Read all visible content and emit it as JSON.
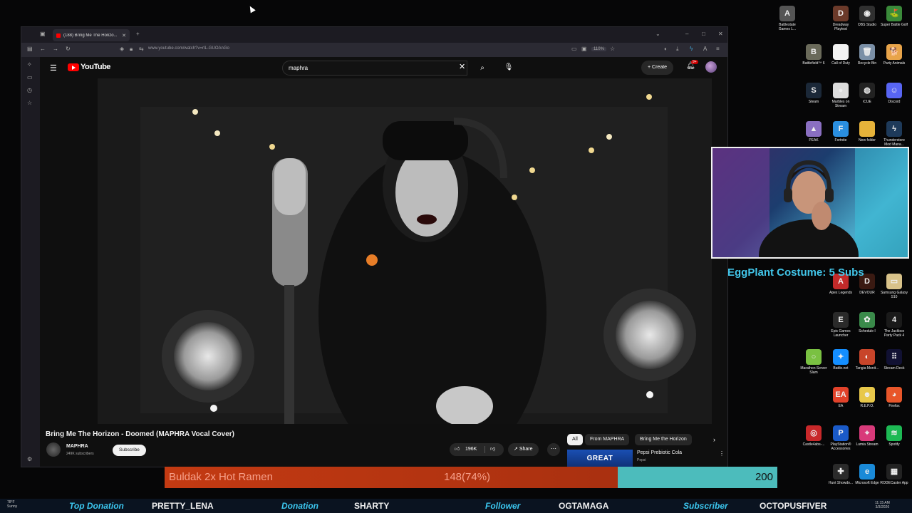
{
  "browser": {
    "tab_title": "(188) Bring Me The Horizo...",
    "url": "www.youtube.com/watch?v=rIL-GUOAnGo",
    "zoom": "110%"
  },
  "youtube": {
    "logo_text": "YouTube",
    "search_query": "maphra",
    "create_label": "Create",
    "notification_count": "9+",
    "video_title": "Bring Me The Horizon - Doomed (MAPHRA Vocal Cover)",
    "channel_name": "MAPHRA",
    "channel_subs": "249K subscribers",
    "subscribe_label": "Subscribe",
    "likes": "196K",
    "share_label": "Share",
    "chips": [
      "All",
      "From MAPHRA",
      "Bring Me the Horizon"
    ],
    "ad": {
      "thumb_text": "GREAT",
      "title": "Pepsi Prebiotic Cola",
      "brand": "Pepsi"
    }
  },
  "desktop_icons": [
    {
      "label": "Battlestate Games L...",
      "icon": "battlestate-icon",
      "color": "#555555",
      "glyph": "A"
    },
    {
      "label": "Dreadway Playtest",
      "icon": "dreadway-icon",
      "color": "#6b3a2a",
      "glyph": "D"
    },
    {
      "label": "OBS Studio",
      "icon": "obs-icon",
      "color": "#303030",
      "glyph": "◉"
    },
    {
      "label": "Super Battle Golf",
      "icon": "golf-icon",
      "color": "#3a8a3a",
      "glyph": "⛳"
    },
    {
      "label": "Battlefield™ 6",
      "icon": "battlefield-icon",
      "color": "#6a6a5a",
      "glyph": "B"
    },
    {
      "label": "Call of Duty",
      "icon": "cod-icon",
      "color": "#f2f2f2",
      "glyph": ""
    },
    {
      "label": "Recycle Bin",
      "icon": "recycle-bin-icon",
      "color": "#7a8fa6",
      "glyph": "🗑"
    },
    {
      "label": "Party Animals",
      "icon": "party-animals-icon",
      "color": "#e8a44a",
      "glyph": "🐕"
    },
    {
      "label": "Steam",
      "icon": "steam-icon",
      "color": "#1b2838",
      "glyph": "S"
    },
    {
      "label": "Marbles on Stream",
      "icon": "marbles-icon",
      "color": "#dddddd",
      "glyph": "●"
    },
    {
      "label": "iCUE",
      "icon": "icue-icon",
      "color": "#222222",
      "glyph": "◍"
    },
    {
      "label": "Discord",
      "icon": "discord-icon",
      "color": "#5865f2",
      "glyph": "☺"
    },
    {
      "label": "PEAK",
      "icon": "peak-icon",
      "color": "#8a6fc1",
      "glyph": "▲"
    },
    {
      "label": "Fortnite",
      "icon": "fortnite-icon",
      "color": "#2a8fe0",
      "glyph": "F"
    },
    {
      "label": "New folder",
      "icon": "folder-icon",
      "color": "#e6b33a",
      "glyph": ""
    },
    {
      "label": "Thunderstore Mod Mana...",
      "icon": "thunderstore-icon",
      "color": "#1e3a5a",
      "glyph": "ϟ"
    },
    {
      "label": "Apex Legends",
      "icon": "apex-icon",
      "color": "#c22a2a",
      "glyph": "A"
    },
    {
      "label": "DEVOUR",
      "icon": "devour-icon",
      "color": "#3a1a12",
      "glyph": "D"
    },
    {
      "label": "Samsung Galaxy S10",
      "icon": "samsung-icon",
      "color": "#d8c28a",
      "glyph": "▭"
    },
    {
      "label": "Epic Games Launcher",
      "icon": "epic-icon",
      "color": "#2a2a2a",
      "glyph": "E"
    },
    {
      "label": "Schedule I",
      "icon": "schedule-icon",
      "color": "#3a8a4a",
      "glyph": "✿"
    },
    {
      "label": "The Jackbox Party Pack 4",
      "icon": "jackbox-icon",
      "color": "#1a1a1a",
      "glyph": "4"
    },
    {
      "label": "Marathon Server Slam",
      "icon": "marathon-icon",
      "color": "#7ac142",
      "glyph": "○"
    },
    {
      "label": "Battle.net",
      "icon": "battlenet-icon",
      "color": "#148eff",
      "glyph": "✦"
    },
    {
      "label": "Tangia Monit...",
      "icon": "tangia-icon",
      "color": "#c8452a",
      "glyph": "◐"
    },
    {
      "label": "Stream Deck",
      "icon": "streamdeck-icon",
      "color": "#111133",
      "glyph": "⠿"
    },
    {
      "label": "EA",
      "icon": "ea-icon",
      "color": "#e2422a",
      "glyph": "EA"
    },
    {
      "label": "R.E.P.O.",
      "icon": "repo-icon",
      "color": "#e8c84a",
      "glyph": "☻"
    },
    {
      "label": "Firefox",
      "icon": "firefox-icon",
      "color": "#e8562a",
      "glyph": "◕"
    },
    {
      "label": "Castle4abs-...",
      "icon": "castle-icon",
      "color": "#c8282a",
      "glyph": "◎"
    },
    {
      "label": "PlayStation® Accessories",
      "icon": "playstation-icon",
      "color": "#1a5ac8",
      "glyph": "P"
    },
    {
      "label": "Lumia Stream",
      "icon": "lumia-icon",
      "color": "#d83a7a",
      "glyph": "⌖"
    },
    {
      "label": "Spotify",
      "icon": "spotify-icon",
      "color": "#1db954",
      "glyph": "≋"
    },
    {
      "label": "Hunt Showdo...",
      "icon": "hunt-icon",
      "color": "#2a2a2a",
      "glyph": "✚"
    },
    {
      "label": "Microsoft Edge",
      "icon": "edge-icon",
      "color": "#1a8ad8",
      "glyph": "e"
    },
    {
      "label": "RODECaster App",
      "icon": "rodecaster-icon",
      "color": "#222222",
      "glyph": "▦"
    }
  ],
  "overlay": {
    "sub_goal_text": "EggPlant Costume: 5 Subs",
    "goal": {
      "name": "Buldak 2x Hot Ramen",
      "progress_text": "148(74%)",
      "fraction": 0.74,
      "target": "200"
    },
    "ticker": [
      {
        "label": "Top Donation",
        "value": "PRETTY_LENA"
      },
      {
        "label": "Donation",
        "value": "SHARTY"
      },
      {
        "label": "Follower",
        "value": "OGTAMAGA"
      },
      {
        "label": "Subscriber",
        "value": "OCTOPUSFIVER"
      }
    ]
  },
  "taskbar": {
    "weather_temp": "78°F",
    "weather_desc": "Sunny",
    "time": "11:15 AM",
    "date": "3/3/2026"
  }
}
